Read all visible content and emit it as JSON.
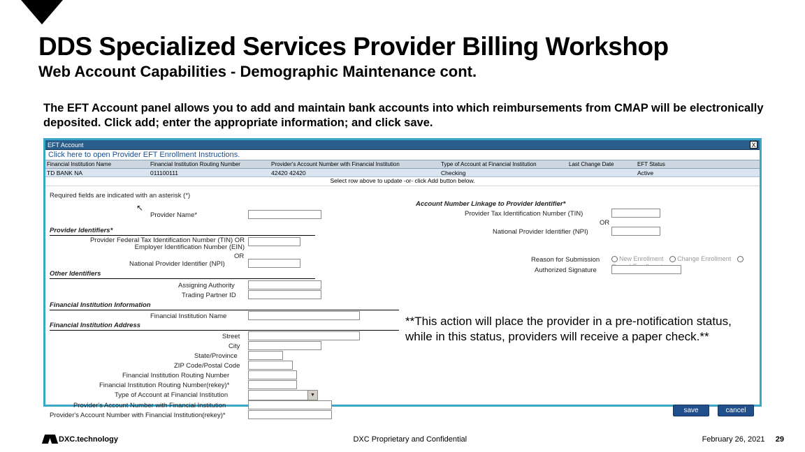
{
  "header": {
    "title": "DDS Specialized Services Provider Billing Workshop",
    "subtitle": "Web Account Capabilities - Demographic Maintenance cont."
  },
  "body": "The EFT Account panel allows you to add and maintain bank accounts into which reimbursements from CMAP will be electronically deposited.  Click add; enter the appropriate information; and click save.",
  "panel": {
    "titlebar": "EFT Account",
    "instructions_link": "Click here to open Provider EFT Enrollment Instructions.",
    "columns": {
      "c1": "Financial Institution Name",
      "c2": "Financial Institution Routing Number",
      "c3": "Provider's Account Number with Financial Institution",
      "c4": "Type of Account at Financial Institution",
      "c5": "Last Change Date",
      "c6": "EFT Status"
    },
    "row": {
      "name": "TD BANK NA",
      "routing": "011100111",
      "acct": "42420 42420",
      "type": "Checking",
      "date": "",
      "status": "Active"
    },
    "select_msg": "Select row above to update -or- click Add button below.",
    "required_note": "Required fields are indicated with an asterisk (*)",
    "labels": {
      "provider_name": "Provider Name*",
      "sec_provider_ids": "Provider Identifiers*",
      "tin_ein": "Provider Federal Tax Identification Number (TIN) OR Employer Identification Number (EIN)",
      "or1": "OR",
      "npi": "National Provider Identifier (NPI)",
      "sec_other_ids": "Other Identifiers",
      "assigning_authority": "Assigning Authority",
      "trading_partner": "Trading Partner ID",
      "sec_fin_inst": "Financial Institution Information",
      "fin_name": "Financial Institution Name",
      "sec_fin_addr": "Financial Institution Address",
      "street": "Street",
      "city": "City",
      "state": "State/Province",
      "zip": "ZIP Code/Postal Code",
      "routing": "Financial Institution Routing Number",
      "routing_rekey": "Financial Institution Routing Number(rekey)*",
      "acct_type": "Type of Account at Financial Institution",
      "acct_num": "Provider's Account Number with Financial Institution",
      "acct_num_rekey": "Provider's Account Number with Financial Institution(rekey)*",
      "linkage_header": "Account Number Linkage to Provider Identifier*",
      "link_tin": "Provider Tax Identification Number (TIN)",
      "link_or": "OR",
      "link_npi": "National Provider Identifier (NPI)",
      "reason": "Reason for Submission",
      "r_new": "New Enrollment",
      "r_change": "Change Enrollment",
      "r_cancel": "Cancel Enrollment",
      "auth_sig": "Authorized Signature"
    },
    "buttons": {
      "save": "save",
      "cancel": "cancel"
    }
  },
  "note": "**This action will place the provider in a pre-notification status, while in this status, providers will receive a paper check.**",
  "footer": {
    "brand": "DXC.technology",
    "center": "DXC Proprietary and Confidential",
    "date": "February 26, 2021",
    "page": "29"
  }
}
